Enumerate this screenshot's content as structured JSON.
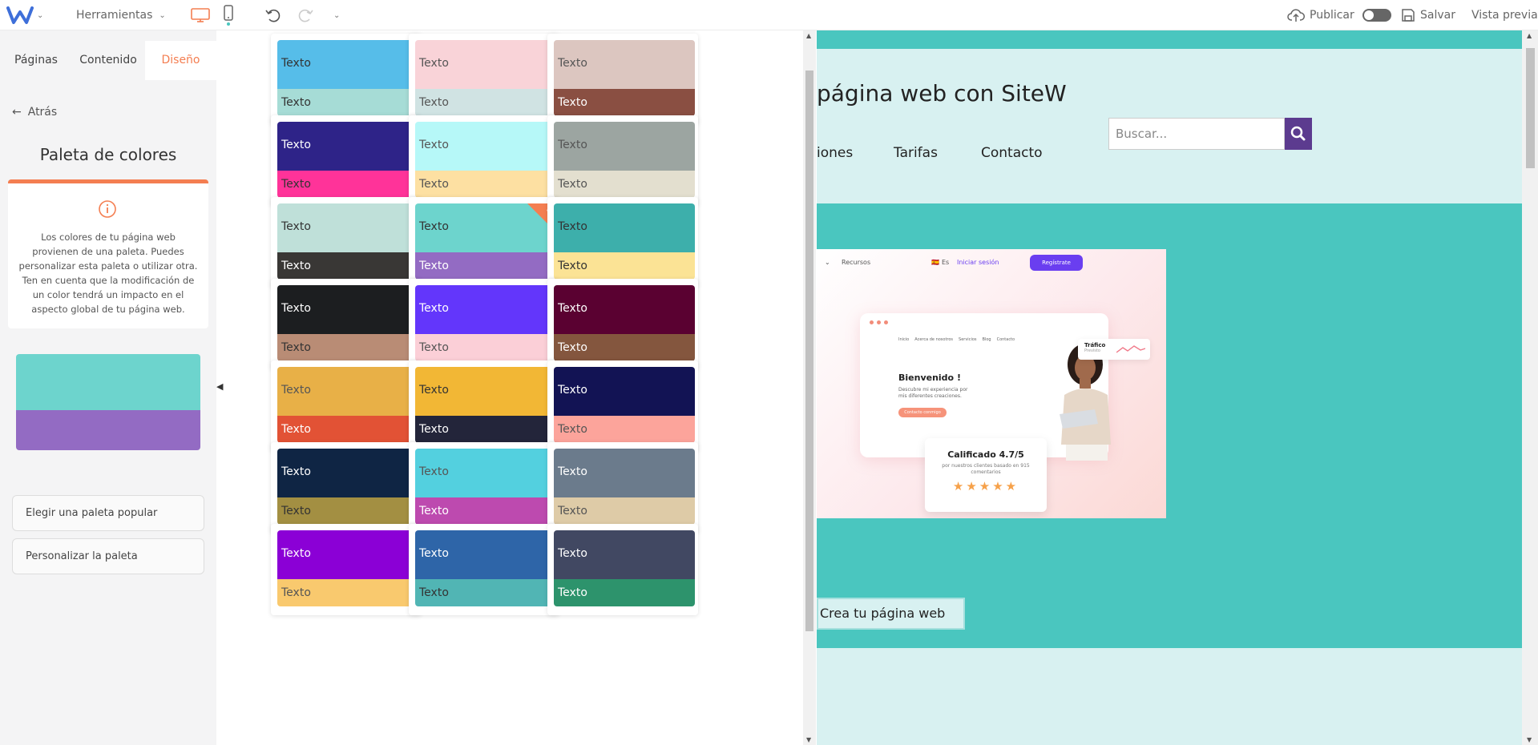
{
  "topbar": {
    "tools_label": "Herramientas",
    "publish_label": "Publicar",
    "save_label": "Salvar",
    "preview_label": "Vista previa"
  },
  "tabs": [
    {
      "label": "Páginas"
    },
    {
      "label": "Contenido"
    },
    {
      "label": "Diseño"
    }
  ],
  "panel": {
    "back_label": "Atrás",
    "title": "Paleta de colores",
    "info_text": "Los colores de tu página web provienen de una paleta. Puedes personalizar esta paleta o utilizar otra. Ten en cuenta que la modificación de un color tendrá un impacto en el aspecto global de tu página web.",
    "current_palette": {
      "top": "#6dd4cd",
      "bottom": "#936bc3"
    },
    "popular_button": "Elegir una paleta popular",
    "custom_button": "Personalizar la paleta"
  },
  "palettes": [
    {
      "top": "#56bde9",
      "top_text": "#333333",
      "bottom": "#a6dcd6",
      "bottom_text": "#333333",
      "top_label": "Texto",
      "bottom_label": "Texto"
    },
    {
      "top": "#f9d3d8",
      "top_text": "#555555",
      "bottom": "#d0e3e3",
      "bottom_text": "#555555",
      "top_label": "Texto",
      "bottom_label": "Texto"
    },
    {
      "top": "#dcc6c0",
      "top_text": "#555555",
      "bottom": "#8a4f42",
      "bottom_text": "#ffffff",
      "top_label": "Texto",
      "bottom_label": "Texto"
    },
    {
      "top": "#2e2388",
      "top_text": "#ffffff",
      "bottom": "#ff3399",
      "bottom_text": "#333333",
      "top_label": "Texto",
      "bottom_label": "Texto"
    },
    {
      "top": "#b6f8f8",
      "top_text": "#555555",
      "bottom": "#fde0a2",
      "bottom_text": "#555555",
      "top_label": "Texto",
      "bottom_label": "Texto"
    },
    {
      "top": "#9ca5a1",
      "top_text": "#555555",
      "bottom": "#e3dfcf",
      "bottom_text": "#555555",
      "top_label": "Texto",
      "bottom_label": "Texto"
    },
    {
      "top": "#bfe0d9",
      "top_text": "#333333",
      "bottom": "#393735",
      "bottom_text": "#ffffff",
      "top_label": "Texto",
      "bottom_label": "Texto"
    },
    {
      "top": "#6dd4cd",
      "top_text": "#333333",
      "bottom": "#936bc3",
      "bottom_text": "#ffffff",
      "top_label": "Texto",
      "bottom_label": "Texto",
      "selected": true
    },
    {
      "top": "#3dafab",
      "top_text": "#333333",
      "bottom": "#fbe395",
      "bottom_text": "#333333",
      "top_label": "Texto",
      "bottom_label": "Texto"
    },
    {
      "top": "#1c1e20",
      "top_text": "#ffffff",
      "bottom": "#b98c75",
      "bottom_text": "#333333",
      "top_label": "Texto",
      "bottom_label": "Texto"
    },
    {
      "top": "#6336fb",
      "top_text": "#ffffff",
      "bottom": "#fbcfd7",
      "bottom_text": "#555555",
      "top_label": "Texto",
      "bottom_label": "Texto"
    },
    {
      "top": "#5a0131",
      "top_text": "#ffffff",
      "bottom": "#84563e",
      "bottom_text": "#ffffff",
      "top_label": "Texto",
      "bottom_label": "Texto"
    },
    {
      "top": "#e8b047",
      "top_text": "#555555",
      "bottom": "#e25235",
      "bottom_text": "#ffffff",
      "top_label": "Texto",
      "bottom_label": "Texto"
    },
    {
      "top": "#f2b735",
      "top_text": "#333333",
      "bottom": "#23253a",
      "bottom_text": "#ffffff",
      "top_label": "Texto",
      "bottom_label": "Texto"
    },
    {
      "top": "#121354",
      "top_text": "#ffffff",
      "bottom": "#fca49b",
      "bottom_text": "#555555",
      "top_label": "Texto",
      "bottom_label": "Texto"
    },
    {
      "top": "#0f2544",
      "top_text": "#ffffff",
      "bottom": "#a38f42",
      "bottom_text": "#333333",
      "top_label": "Texto",
      "bottom_label": "Texto"
    },
    {
      "top": "#53d0df",
      "top_text": "#555555",
      "bottom": "#bd4aaf",
      "bottom_text": "#ffffff",
      "top_label": "Texto",
      "bottom_label": "Texto"
    },
    {
      "top": "#6b7b8c",
      "top_text": "#ffffff",
      "bottom": "#decba7",
      "bottom_text": "#555555",
      "top_label": "Texto",
      "bottom_label": "Texto"
    },
    {
      "top": "#8b00d6",
      "top_text": "#ffffff",
      "bottom": "#f9c96e",
      "bottom_text": "#555555",
      "top_label": "Texto",
      "bottom_label": "Texto"
    },
    {
      "top": "#2e65a8",
      "top_text": "#ffffff",
      "bottom": "#51b5b4",
      "bottom_text": "#333333",
      "top_label": "Texto",
      "bottom_label": "Texto"
    },
    {
      "top": "#414862",
      "top_text": "#ffffff",
      "bottom": "#2d936c",
      "bottom_text": "#ffffff",
      "top_label": "Texto",
      "bottom_label": "Texto"
    }
  ],
  "site": {
    "title": "página web con SiteW",
    "nav": [
      "iones",
      "Tarifas",
      "Contacto"
    ],
    "search_placeholder": "Buscar...",
    "cta_label": "Crea tu página web",
    "hero": {
      "nav_recursos": "Recursos",
      "nav_lang": "Es",
      "nav_login": "Iniciar sesión",
      "nav_register": "Regístrate",
      "welcome": "Bienvenido !",
      "welcome_sub": "Descubre mi experiencia por mis diferentes creaciones.",
      "cta": "Contacto conmigo",
      "browser_nav": [
        "Inicio",
        "Acerca de nosotros",
        "Servicios",
        "Blog",
        "Contacto"
      ],
      "traffic_title": "Tráfico",
      "traffic_sub": "Previsto",
      "rating_title": "Calificado 4.7/5",
      "rating_sub": "por nuestros clientes basado en 915 comentarios",
      "stars": "★★★★★"
    }
  }
}
